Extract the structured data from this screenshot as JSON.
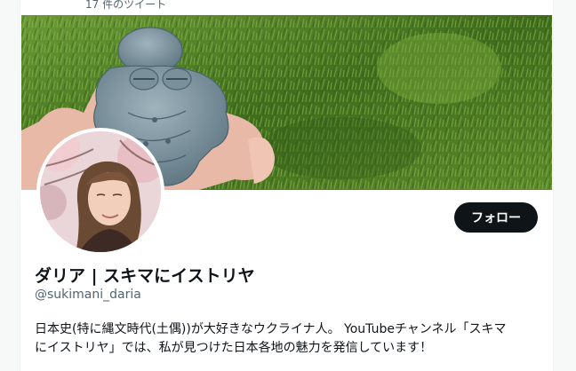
{
  "header": {
    "tweet_count": "17 件のツイート"
  },
  "profile": {
    "name": "ダリア | スキマにイストリヤ",
    "handle": "@sukimani_daria",
    "follow_label": "フォロー",
    "bio_line1": "日本史(特に縄文時代(土偶))が大好きなウクライナ人。 YouTubeチャンネル「スキマ",
    "bio_line2": "にイストリヤ」では、私が見つけた日本各地の魅力を発信しています！"
  },
  "colors": {
    "button": "#0f1419",
    "text": "#0f1419",
    "secondary": "#536471",
    "banner_grass": "#4d7a24"
  }
}
